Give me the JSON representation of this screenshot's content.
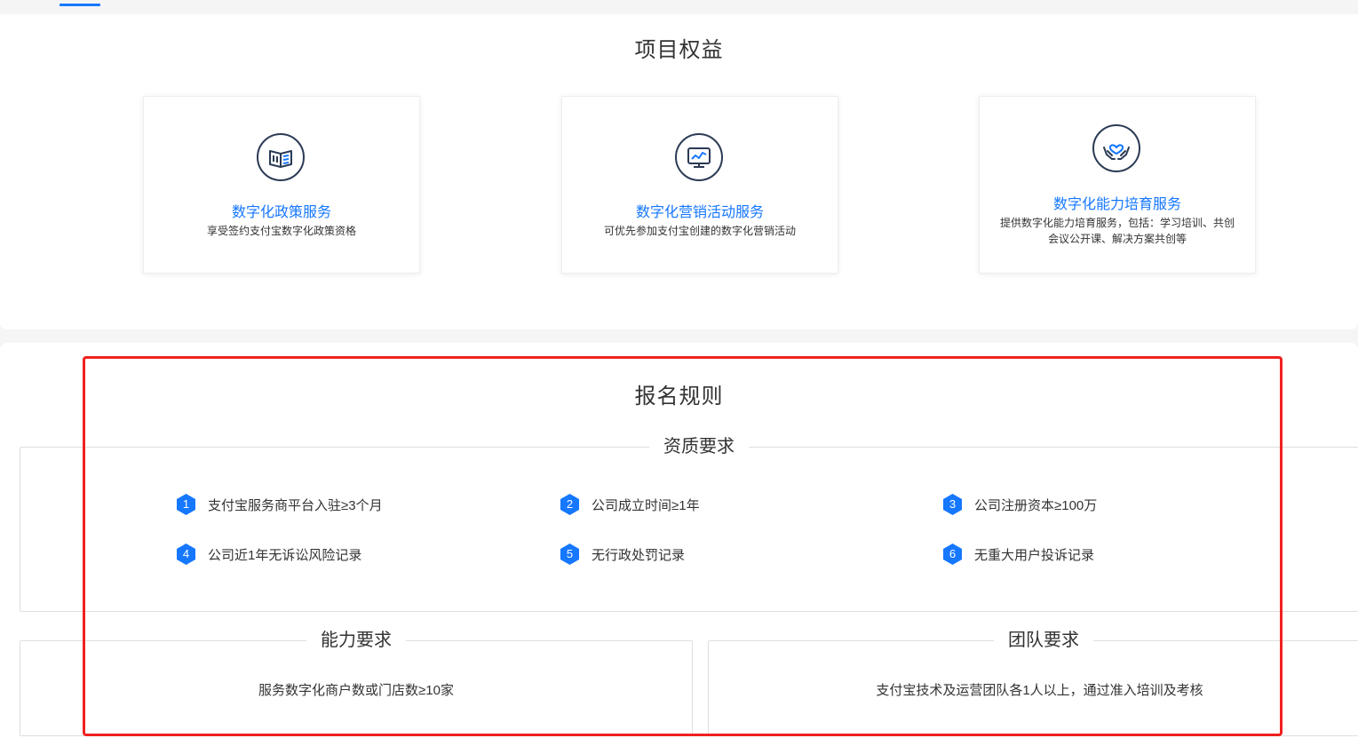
{
  "benefits": {
    "title": "项目权益",
    "cards": [
      {
        "icon": "policy-book-icon",
        "name": "数字化政策服务",
        "desc": "享受签约支付宝数字化政策资格"
      },
      {
        "icon": "marketing-monitor-icon",
        "name": "数字化营销活动服务",
        "desc": "可优先参加支付宝创建的数字化营销活动"
      },
      {
        "icon": "care-hands-heart-icon",
        "name": "数字化能力培育服务",
        "desc": "提供数字化能力培育服务，包括：学习培训、共创会议公开课、解决方案共创等"
      }
    ]
  },
  "rules": {
    "title": "报名规则",
    "qualification": {
      "legend": "资质要求",
      "items": [
        {
          "num": "1",
          "text": "支付宝服务商平台入驻≥3个月"
        },
        {
          "num": "2",
          "text": "公司成立时间≥1年"
        },
        {
          "num": "3",
          "text": "公司注册资本≥100万"
        },
        {
          "num": "4",
          "text": "公司近1年无诉讼风险记录"
        },
        {
          "num": "5",
          "text": "无行政处罚记录"
        },
        {
          "num": "6",
          "text": "无重大用户投诉记录"
        }
      ]
    },
    "ability": {
      "legend": "能力要求",
      "text": "服务数字化商户数或门店数≥10家"
    },
    "team": {
      "legend": "团队要求",
      "text": "支付宝技术及运营团队各1人以上，通过准入培训及考核"
    }
  },
  "colors": {
    "accent": "#1677ff",
    "highlight": "#f0211f",
    "icon_stroke": "#2b3a55"
  }
}
